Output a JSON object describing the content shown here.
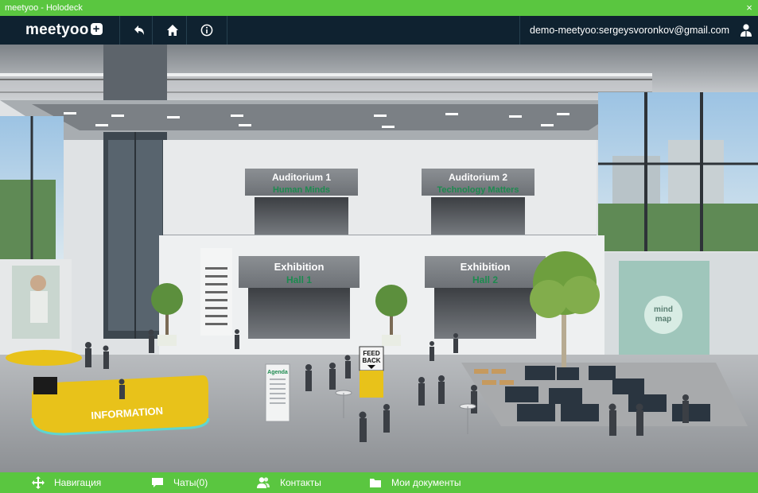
{
  "window": {
    "title": "meetyoo - Holodeck",
    "close_glyph": "×"
  },
  "topnav": {
    "logo_text": "meetyoo",
    "logo_plus": "+",
    "back_icon": "back-arrow-icon",
    "home_icon": "home-icon",
    "info_icon": "info-icon",
    "user_email": "demo-meetyoo:sergeysvoronkov@gmail.com",
    "user_icon": "user-icon"
  },
  "scene": {
    "auditorium1": {
      "title": "Auditorium 1",
      "subtitle": "Human Minds"
    },
    "auditorium2": {
      "title": "Auditorium 2",
      "subtitle": "Technology Matters"
    },
    "exhibition1": {
      "title": "Exhibition",
      "subtitle": "Hall 1"
    },
    "exhibition2": {
      "title": "Exhibition",
      "subtitle": "Hall 2"
    },
    "feedback_line1": "FEED",
    "feedback_line2": "BACK",
    "agenda_label": "Agenda",
    "information_label": "INFORMATION",
    "mindmap_line1": "mind",
    "mindmap_line2": "map"
  },
  "bottombar": {
    "items": [
      {
        "label": "Навигация",
        "icon": "navigation-icon"
      },
      {
        "label": "Чаты(0)",
        "icon": "chat-icon"
      },
      {
        "label": "Контакты",
        "icon": "contacts-icon"
      },
      {
        "label": "Мои документы",
        "icon": "documents-icon"
      }
    ]
  },
  "colors": {
    "accent_green": "#5ac640",
    "nav_dark": "#0f2230",
    "info_desk_yellow": "#e8c21a"
  }
}
